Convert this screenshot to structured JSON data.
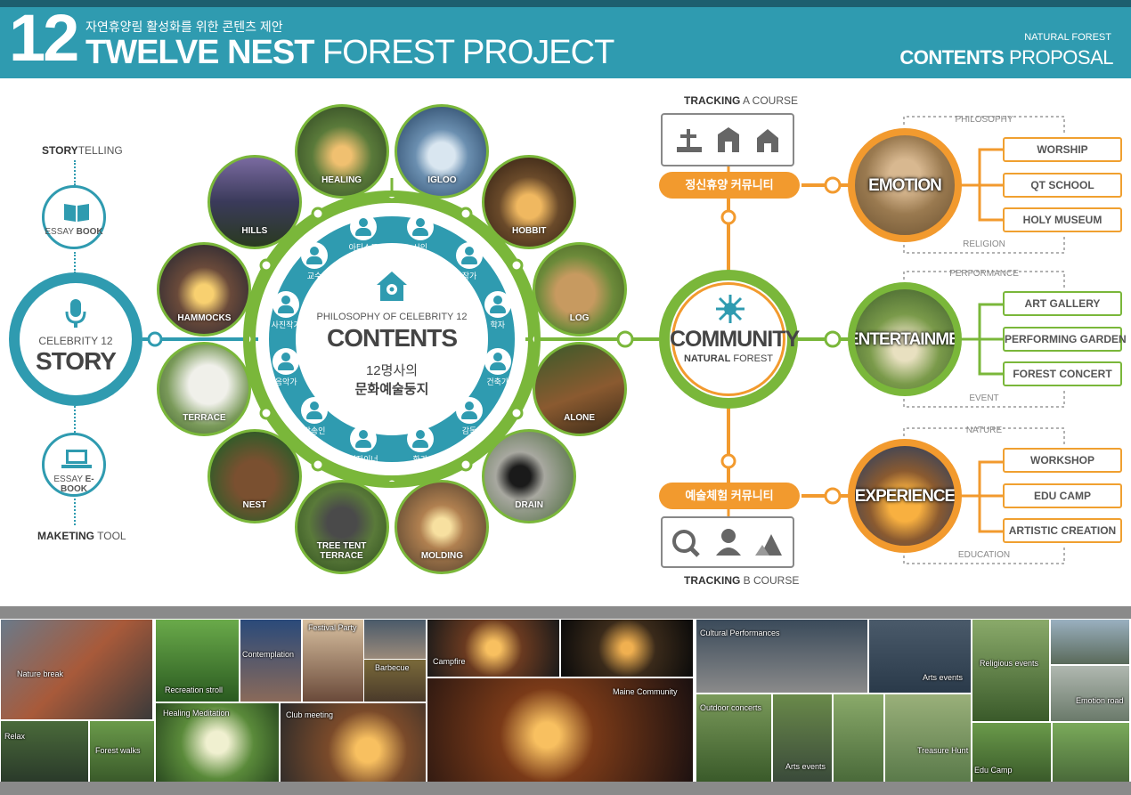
{
  "header": {
    "number": "12",
    "subtitle": "자연휴양림 활성화를 위한 콘텐츠 제안",
    "title_bold": "TWELVE NEST",
    "title_rest": " FOREST PROJECT",
    "right_small": "NATURAL FOREST",
    "right_bold": "CONTENTS",
    "right_rest": " PROPOSAL"
  },
  "story": {
    "top_label_bold": "STORY",
    "top_label_rest": "TELLING",
    "essay_book_pre": "ESSAY ",
    "essay_book_bold": "BOOK",
    "celebrity": "CELEBRITY 12",
    "story_word": "STORY",
    "ebook_pre": "ESSAY ",
    "ebook_bold": "E-BOOK",
    "bottom_label_bold": "MAKETING",
    "bottom_label_rest": " TOOL"
  },
  "center": {
    "philosophy": "PHILOSOPHY OF CELEBRITY 12",
    "contents": "CONTENTS",
    "line1": "12명사의",
    "line2": "문화예술둥지"
  },
  "roles": [
    "시인",
    "작가",
    "학자",
    "건축가",
    "감독",
    "화가",
    "디자이너",
    "방송인",
    "음악가",
    "사진작가",
    "교수",
    "아티스트"
  ],
  "nests": [
    {
      "name": "IGLOO"
    },
    {
      "name": "HOBBIT"
    },
    {
      "name": "LOG"
    },
    {
      "name": "ALONE"
    },
    {
      "name": "DRAIN"
    },
    {
      "name": "MOLDING"
    },
    {
      "name": "TREE TENT TERRACE"
    },
    {
      "name": "NEST"
    },
    {
      "name": "TERRACE"
    },
    {
      "name": "HAMMOCKS"
    },
    {
      "name": "HILLS"
    },
    {
      "name": "HEALING"
    }
  ],
  "tracking": {
    "a_bold": "TRACKING",
    "a_rest": " A COURSE",
    "b_bold": "TRACKING",
    "b_rest": " B COURSE",
    "pill_top": "정신휴양 커뮤니티",
    "pill_bottom": "예술체험 커뮤니티"
  },
  "community": {
    "word": "COMMUNITY",
    "sub_bold": "NATURAL",
    "sub_rest": " FOREST"
  },
  "groups": [
    {
      "name": "EMOTION",
      "top": "PHILOSOPHY",
      "bottom": "RELIGION",
      "items": [
        "WORSHIP",
        "QT SCHOOL",
        "HOLY MUSEUM"
      ]
    },
    {
      "name": "ENTERTAINMENT",
      "top": "PERFORMANCE",
      "bottom": "EVENT",
      "items": [
        "ART GALLERY",
        "PERFORMING GARDEN",
        "FOREST CONCERT"
      ]
    },
    {
      "name": "EXPERIENCE",
      "top": "NATURE",
      "bottom": "EDUCATION",
      "items": [
        "WORKSHOP",
        "EDU CAMP",
        "ARTISTIC CREATION"
      ]
    }
  ],
  "photos": {
    "nature_break": "Nature break",
    "relax": "Relax",
    "forest_walks": "Forest walks",
    "recreation_stroll": "Recreation stroll",
    "contemplation": "Contemplation",
    "festival_party": "Festival Party",
    "barbecue": "Barbecue",
    "healing_meditation": "Healing Meditation",
    "club_meeting": "Club meeting",
    "campfire": "Campfire",
    "maine_community": "Maine Community",
    "cultural_performances": "Cultural Performances",
    "arts_events_1": "Arts events",
    "religious_events": "Religious events",
    "outdoor_concerts": "Outdoor concerts",
    "arts_events_2": "Arts events",
    "treasure_hunt": "Treasure Hunt",
    "edu_camp": "Edu Camp",
    "emotion_road": "Emotion road"
  },
  "colors": {
    "teal": "#2f9bb0",
    "green": "#7ab73a",
    "orange": "#f29a2e"
  }
}
